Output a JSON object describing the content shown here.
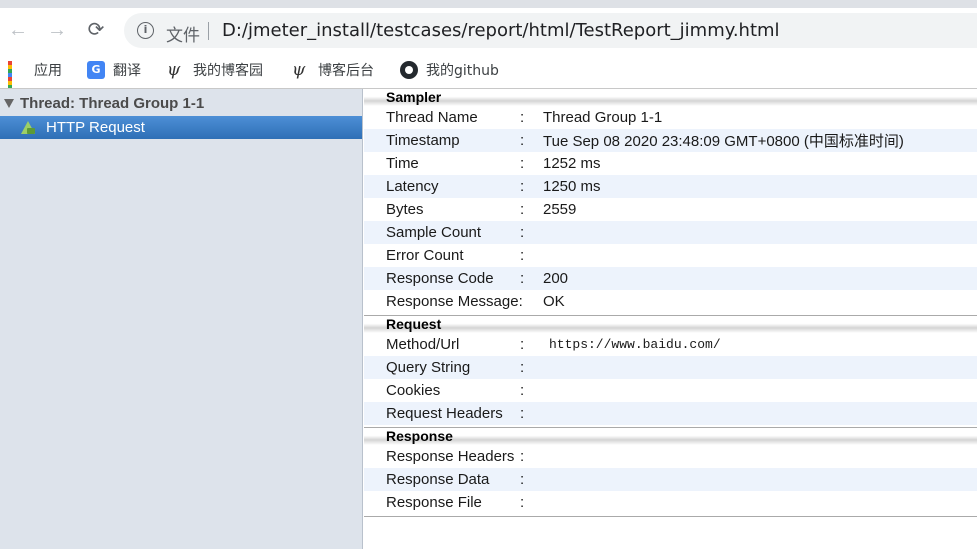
{
  "browser": {
    "nav": {
      "back_icon": "←",
      "forward_icon": "→",
      "reload_icon": "⟳"
    },
    "address": {
      "info_icon": "i",
      "file_label": "文件",
      "url": "D:/jmeter_install/testcases/report/html/TestReport_jimmy.html"
    },
    "bookmarks": [
      {
        "label": "应用",
        "icon": "apps-grid-icon"
      },
      {
        "label": "翻译",
        "icon": "translate-icon"
      },
      {
        "label": "我的博客园",
        "icon": "cnblogs-icon"
      },
      {
        "label": "博客后台",
        "icon": "cnblogs-icon"
      },
      {
        "label": "我的github",
        "icon": "github-icon"
      }
    ]
  },
  "tree": {
    "root": "Thread: Thread Group 1-1",
    "item": "HTTP Request"
  },
  "details": {
    "sampler": {
      "title": "Sampler",
      "rows": [
        {
          "k": "Thread Name",
          "c": ":",
          "v": "Thread Group 1-1"
        },
        {
          "k": "Timestamp",
          "c": ":",
          "v": "Tue Sep 08 2020 23:48:09 GMT+0800 (中国标准时间)"
        },
        {
          "k": "Time",
          "c": ":",
          "v": "1252 ms"
        },
        {
          "k": "Latency",
          "c": ":",
          "v": "1250 ms"
        },
        {
          "k": "Bytes",
          "c": ":",
          "v": "2559"
        },
        {
          "k": "Sample Count",
          "c": ":",
          "v": ""
        },
        {
          "k": "Error Count",
          "c": ":",
          "v": ""
        },
        {
          "k": "Response Code",
          "c": ":",
          "v": "200"
        },
        {
          "k": "Response Message:",
          "c": "",
          "v": "OK"
        }
      ]
    },
    "request": {
      "title": "Request",
      "rows": [
        {
          "k": "Method/Url",
          "c": ":",
          "v": "https://www.baidu.com/"
        },
        {
          "k": "Query String",
          "c": ":",
          "v": ""
        },
        {
          "k": "Cookies",
          "c": ":",
          "v": ""
        },
        {
          "k": "Request Headers",
          "c": ":",
          "v": ""
        }
      ]
    },
    "response": {
      "title": "Response",
      "rows": [
        {
          "k": "Response Headers",
          "c": ":",
          "v": ""
        },
        {
          "k": "Response Data",
          "c": ":",
          "v": ""
        },
        {
          "k": "Response File",
          "c": ":",
          "v": ""
        }
      ]
    }
  },
  "colors": {
    "selection": "#3b7dc5",
    "tree_bg": "#dde3eb",
    "row_alt": "#edf3fc"
  }
}
